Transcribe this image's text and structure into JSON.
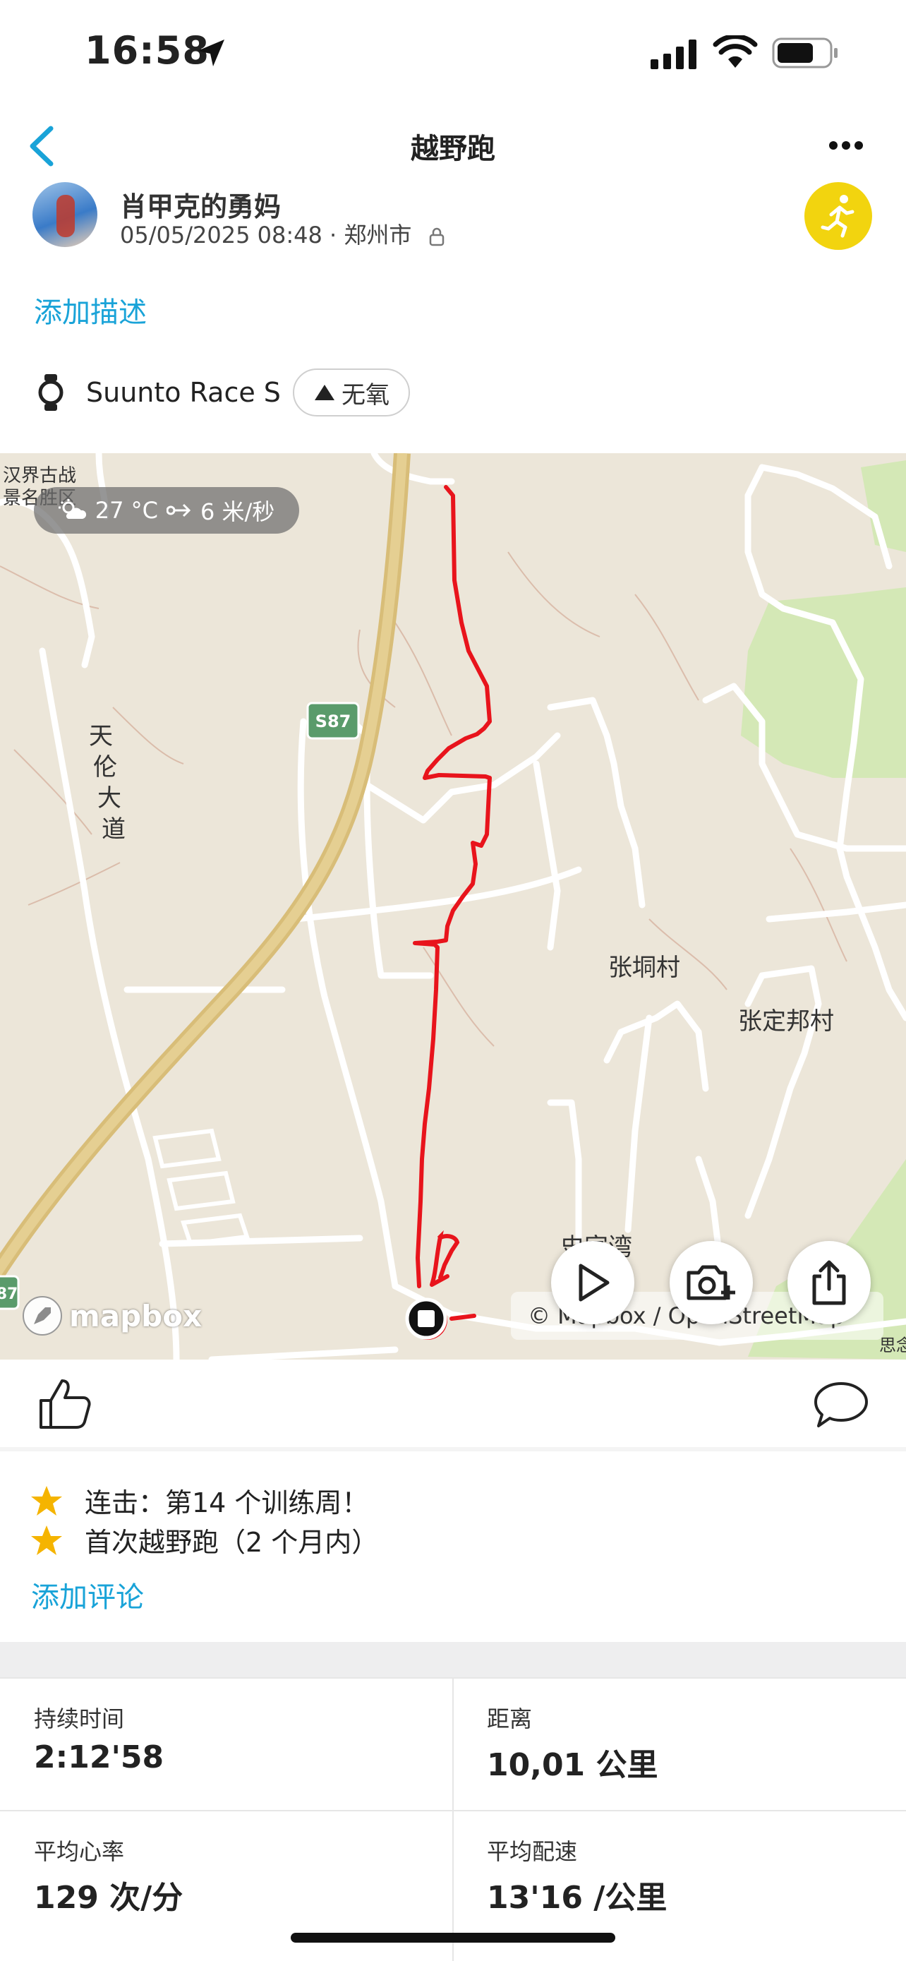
{
  "status_bar": {
    "time": "16:58"
  },
  "nav": {
    "title": "越野跑"
  },
  "header": {
    "user_name": "肖甲克的勇妈",
    "meta": "05/05/2025 08:48 · 郑州市",
    "add_description": "添加描述",
    "device": "Suunto Race S",
    "tag": "无氧"
  },
  "map": {
    "weather": {
      "temperature": "27 °C",
      "wind": "6 米/秒"
    },
    "labels": {
      "poi": "汉界古战景名胜区",
      "poi_line1": "汉界古战",
      "poi_line2": "景名胜区",
      "road": "天伦大道",
      "highway": "S87",
      "highway_edge": "87",
      "village1": "张垌村",
      "village2": "张定邦村",
      "village3": "史家湾",
      "edge_text": "思念"
    },
    "logo": "mapbox",
    "attribution": "© Mapbox / OpenStreetMap",
    "colors": {
      "route": "#e8141c",
      "road_major": "#dfc67a",
      "park": "#d4e8b6"
    }
  },
  "activity": {
    "achievements": [
      {
        "text": "连击：第14 个训练周！",
        "icon": "star-icon"
      },
      {
        "text": "首次越野跑（2 个月内）",
        "icon": "star-icon"
      }
    ],
    "add_comment": "添加评论"
  },
  "stats": [
    {
      "label": "持续时间",
      "value": "2:12'58"
    },
    {
      "label": "距离",
      "value": "10,01 公里"
    },
    {
      "label": "平均心率",
      "value": "129 次/分"
    },
    {
      "label": "平均配速",
      "value": "13'16 /公里"
    }
  ],
  "accent_color": "#19a3d8"
}
